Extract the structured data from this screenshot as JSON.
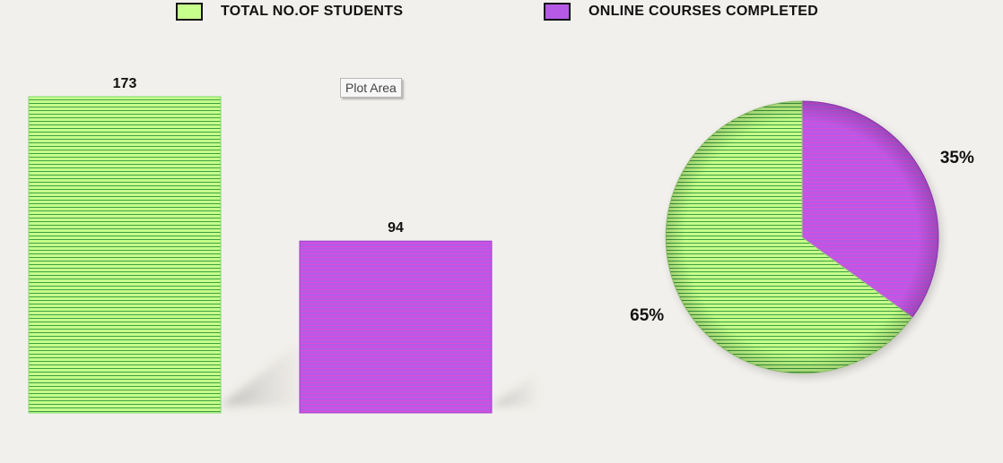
{
  "chart_data": [
    {
      "type": "bar",
      "categories": [
        "TOTAL NO.OF STUDENTS",
        "ONLINE COURSES COMPLETED"
      ],
      "values": [
        173,
        94
      ],
      "data_labels": [
        "173",
        "94"
      ],
      "ylim": [
        0,
        173
      ],
      "colors": [
        "#c6ff8c",
        "#b65ae6"
      ],
      "grid": false
    },
    {
      "type": "pie",
      "categories": [
        "TOTAL NO.OF STUDENTS",
        "ONLINE COURSES COMPLETED"
      ],
      "values": [
        65,
        35
      ],
      "data_labels": [
        "65%",
        "35%"
      ],
      "colors": [
        "#c6ff8c",
        "#b65ae6"
      ]
    }
  ],
  "legend": {
    "items": [
      {
        "label": "TOTAL NO.OF STUDENTS",
        "color": "#c6ff8c"
      },
      {
        "label": "ONLINE COURSES COMPLETED",
        "color": "#b65ae6"
      }
    ]
  },
  "tooltip": {
    "text": "Plot Area"
  },
  "colors": {
    "background": "#f2f0ec",
    "green_hatch": "#3fa03f",
    "purple_hatch": "#e04ad8",
    "shadow": "#bdbbb8"
  }
}
